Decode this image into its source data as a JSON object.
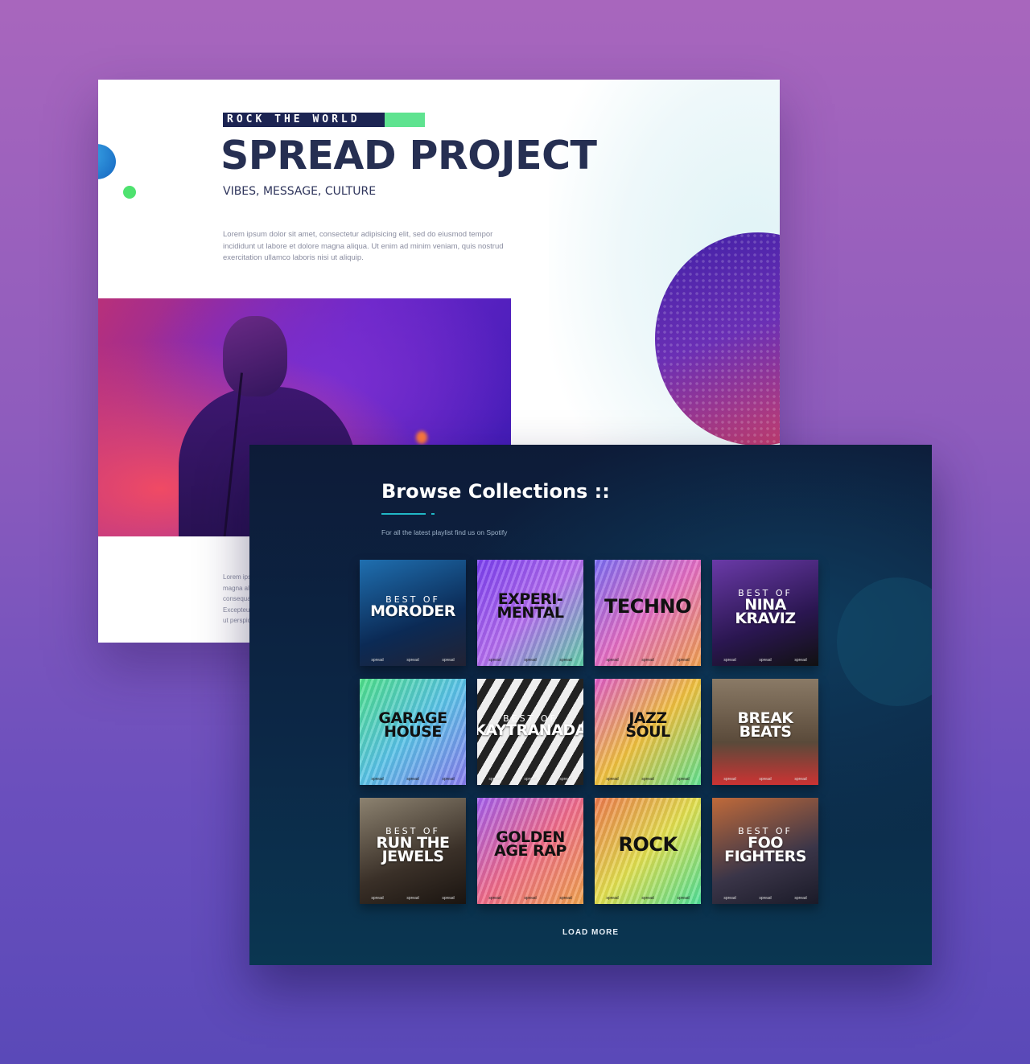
{
  "hero": {
    "tag": "ROCK THE WORLD",
    "title": "SPREAD PROJECT",
    "subtitle": "VIBES, MESSAGE, CULTURE",
    "body": "Lorem ipsum dolor sit amet, consectetur adipisicing elit, sed do eiusmod tempor incididunt ut labore et dolore magna aliqua. Ut enim ad minim veniam, quis nostrud exercitation ullamco laboris nisi ut aliquip.",
    "body_lines": [
      "Lorem ips",
      "magna ali",
      "consequa",
      "Excepteur",
      "ut perspic"
    ]
  },
  "browse": {
    "title": "Browse Collections ::",
    "subtitle": "For all the latest playlist find us on Spotify",
    "load_more": "LOAD MORE",
    "tiles": [
      {
        "pre": "BEST OF",
        "main": "MORODER",
        "style": "photo"
      },
      {
        "pre": "",
        "main": "EXPERI-\nMENTAL",
        "style": "wave"
      },
      {
        "pre": "",
        "main": "TECHNO",
        "style": "wave"
      },
      {
        "pre": "BEST OF",
        "main": "NINA\nKRAVIZ",
        "style": "photo"
      },
      {
        "pre": "",
        "main": "GARAGE\nHOUSE",
        "style": "wave"
      },
      {
        "pre": "BEST OF",
        "main": "KAYTRANADA",
        "style": "photo"
      },
      {
        "pre": "",
        "main": "JAZZ\nSOUL",
        "style": "wave"
      },
      {
        "pre": "",
        "main": "BREAK\nBEATS",
        "style": "photo"
      },
      {
        "pre": "BEST OF",
        "main": "RUN THE\nJEWELS",
        "style": "photo"
      },
      {
        "pre": "",
        "main": "GOLDEN\nAGE RAP",
        "style": "wave"
      },
      {
        "pre": "",
        "main": "ROCK",
        "style": "wave"
      },
      {
        "pre": "BEST OF",
        "main": "FOO\nFIGHTERS",
        "style": "photo"
      }
    ],
    "brand": "spread"
  },
  "colors": {
    "accent": "#5fe390",
    "navy": "#1c2452",
    "teal": "#21b7c6"
  }
}
